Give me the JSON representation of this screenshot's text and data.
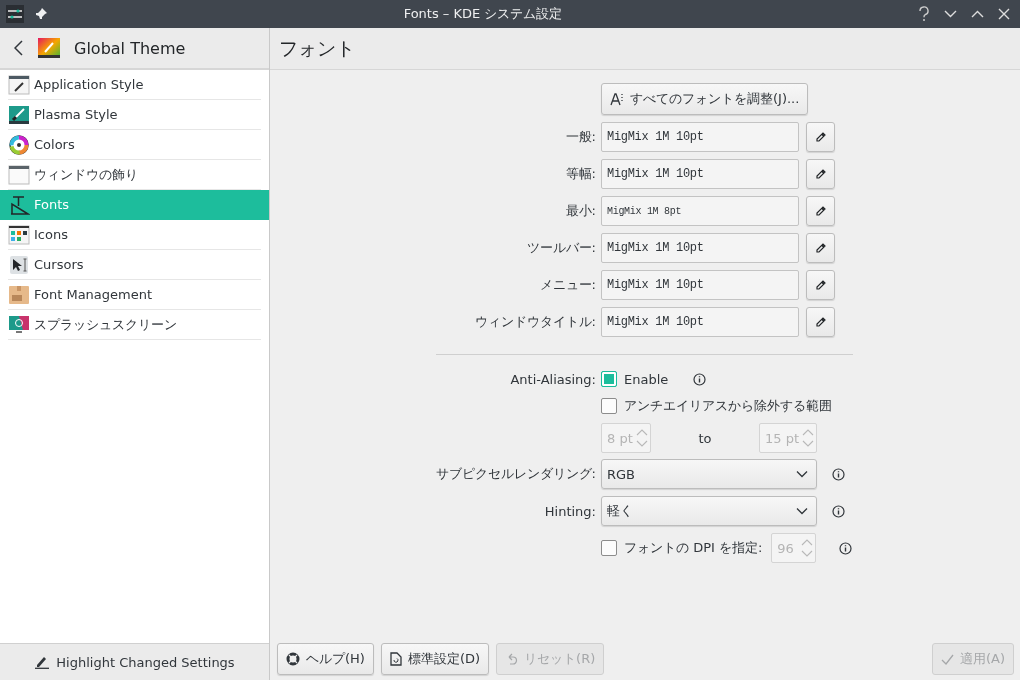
{
  "window": {
    "title": "Fonts – KDE システム設定"
  },
  "sidebar": {
    "title": "Global Theme",
    "items": [
      {
        "label": "Application Style",
        "kind": "app-style",
        "selected": false
      },
      {
        "label": "Plasma Style",
        "kind": "plasma",
        "selected": false
      },
      {
        "label": "Colors",
        "kind": "colors",
        "selected": false
      },
      {
        "label": "ウィンドウの飾り",
        "kind": "window",
        "selected": false
      },
      {
        "label": "Fonts",
        "kind": "fonts",
        "selected": true
      },
      {
        "label": "Icons",
        "kind": "icons",
        "selected": false
      },
      {
        "label": "Cursors",
        "kind": "cursors",
        "selected": false
      },
      {
        "label": "Font Management",
        "kind": "font-mgmt",
        "selected": false
      },
      {
        "label": "スプラッシュスクリーン",
        "kind": "splash",
        "selected": false
      }
    ],
    "footer": "Highlight Changed Settings"
  },
  "page": {
    "title": "フォント",
    "adjust_all_button": "すべてのフォントを調整(J)...",
    "fonts": [
      {
        "label": "一般:",
        "value": "MigMix 1M 10pt",
        "kind": "normal"
      },
      {
        "label": "等幅:",
        "value": "MigMix 1M 10pt",
        "kind": "normal"
      },
      {
        "label": "最小:",
        "value": "MigMix 1M 8pt",
        "kind": "small"
      },
      {
        "label": "ツールバー:",
        "value": "MigMix 1M 10pt",
        "kind": "normal"
      },
      {
        "label": "メニュー:",
        "value": "MigMix 1M 10pt",
        "kind": "normal"
      },
      {
        "label": "ウィンドウタイトル:",
        "value": "MigMix 1M 10pt",
        "kind": "normal"
      }
    ],
    "anti_aliasing": {
      "label": "Anti-Aliasing:",
      "enable": {
        "label": "Enable",
        "checked": true
      },
      "exclude": {
        "label": "アンチエイリアスから除外する範囲",
        "checked": false
      },
      "range_from": {
        "value": "8 pt",
        "disabled": true
      },
      "range_separator": "to",
      "range_to": {
        "value": "15 pt",
        "disabled": true
      }
    },
    "subpixel": {
      "label": "サブピクセルレンダリング:",
      "value": "RGB"
    },
    "hinting": {
      "label": "Hinting:",
      "value": "軽く"
    },
    "dpi": {
      "label": "フォントの DPI を指定:",
      "checked": false,
      "value": "96",
      "disabled": true
    }
  },
  "buttons": [
    {
      "kind": "help",
      "label": "ヘルプ(H)",
      "disabled": false
    },
    {
      "kind": "defaults",
      "label": "標準設定(D)",
      "disabled": false
    },
    {
      "kind": "reset",
      "label": "リセット(R)",
      "disabled": true
    },
    {
      "kind": "apply",
      "label": "適用(A)",
      "disabled": true
    }
  ]
}
